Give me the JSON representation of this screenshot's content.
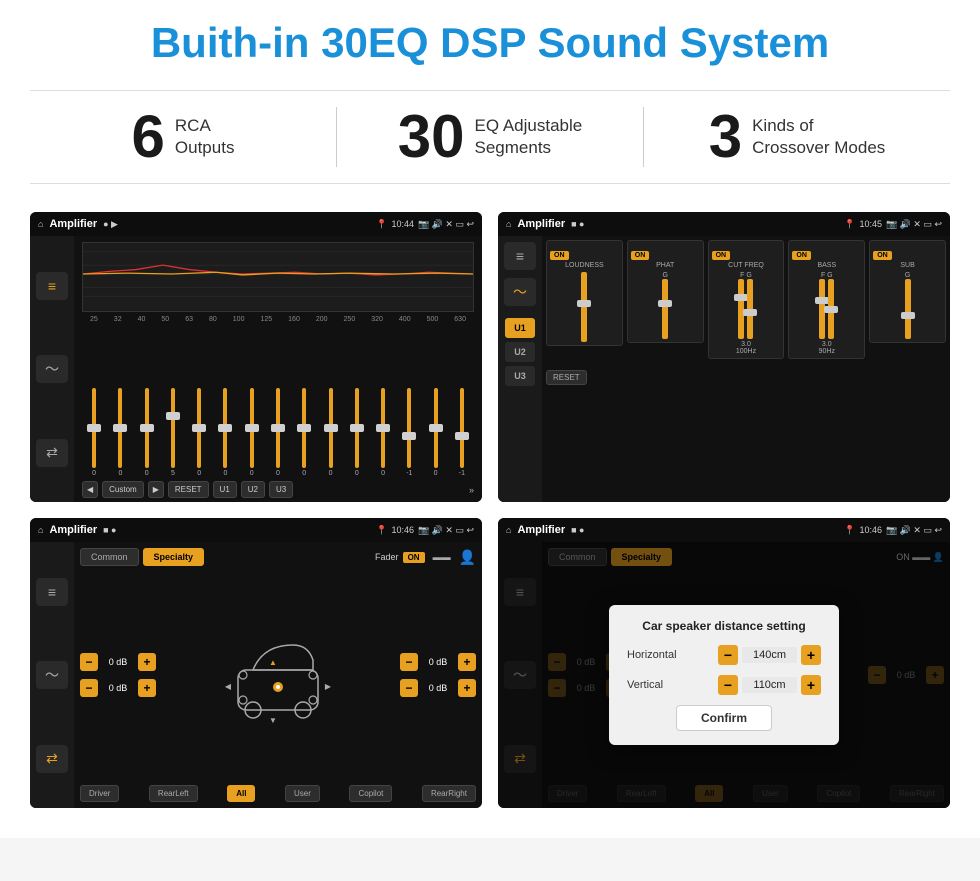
{
  "page": {
    "title": "Buith-in 30EQ DSP Sound System"
  },
  "stats": [
    {
      "number": "6",
      "label": "RCA\nOutputs"
    },
    {
      "number": "30",
      "label": "EQ Adjustable\nSegments"
    },
    {
      "number": "3",
      "label": "Kinds of\nCrossover Modes"
    }
  ],
  "screens": {
    "eq": {
      "title": "Amplifier",
      "time": "10:44",
      "freqs": [
        "25",
        "32",
        "40",
        "50",
        "63",
        "80",
        "100",
        "125",
        "160",
        "200",
        "250",
        "320",
        "400",
        "500",
        "630"
      ],
      "values": [
        "0",
        "0",
        "0",
        "5",
        "0",
        "0",
        "0",
        "0",
        "0",
        "0",
        "0",
        "0",
        "-1",
        "0",
        "-1"
      ],
      "preset": "Custom",
      "buttons": [
        "RESET",
        "U1",
        "U2",
        "U3"
      ]
    },
    "crossover": {
      "title": "Amplifier",
      "time": "10:45",
      "units": [
        "U1",
        "U2",
        "U3"
      ],
      "channels": [
        "LOUDNESS",
        "PHAT",
        "CUT FREQ",
        "BASS",
        "SUB"
      ],
      "reset": "RESET"
    },
    "fader": {
      "title": "Amplifier",
      "time": "10:46",
      "tabs": [
        "Common",
        "Specialty"
      ],
      "fader_label": "Fader",
      "on_label": "ON",
      "db_values": [
        "0 dB",
        "0 dB",
        "0 dB",
        "0 dB"
      ],
      "bottom_btns": [
        "Driver",
        "RearLeft",
        "All",
        "User",
        "Copilot",
        "RearRight"
      ]
    },
    "dialog": {
      "title": "Amplifier",
      "time": "10:46",
      "tabs": [
        "Common",
        "Specialty"
      ],
      "dialog_title": "Car speaker distance setting",
      "horizontal_label": "Horizontal",
      "horizontal_value": "140cm",
      "vertical_label": "Vertical",
      "vertical_value": "110cm",
      "confirm_label": "Confirm",
      "db_values": [
        "0 dB",
        "0 dB"
      ],
      "bottom_btns": [
        "Driver",
        "RearLeft",
        "All",
        "User",
        "Copilot",
        "RearRight"
      ]
    }
  },
  "icons": {
    "home": "⌂",
    "play": "▶",
    "back_play": "◀",
    "location": "📍",
    "speaker": "🔊",
    "settings": "⚙",
    "wave": "〜",
    "sliders": "≡",
    "arrows": "⇄",
    "chevron_down": "▼",
    "chevron_up": "▲",
    "car": "🚗",
    "person": "👤"
  }
}
